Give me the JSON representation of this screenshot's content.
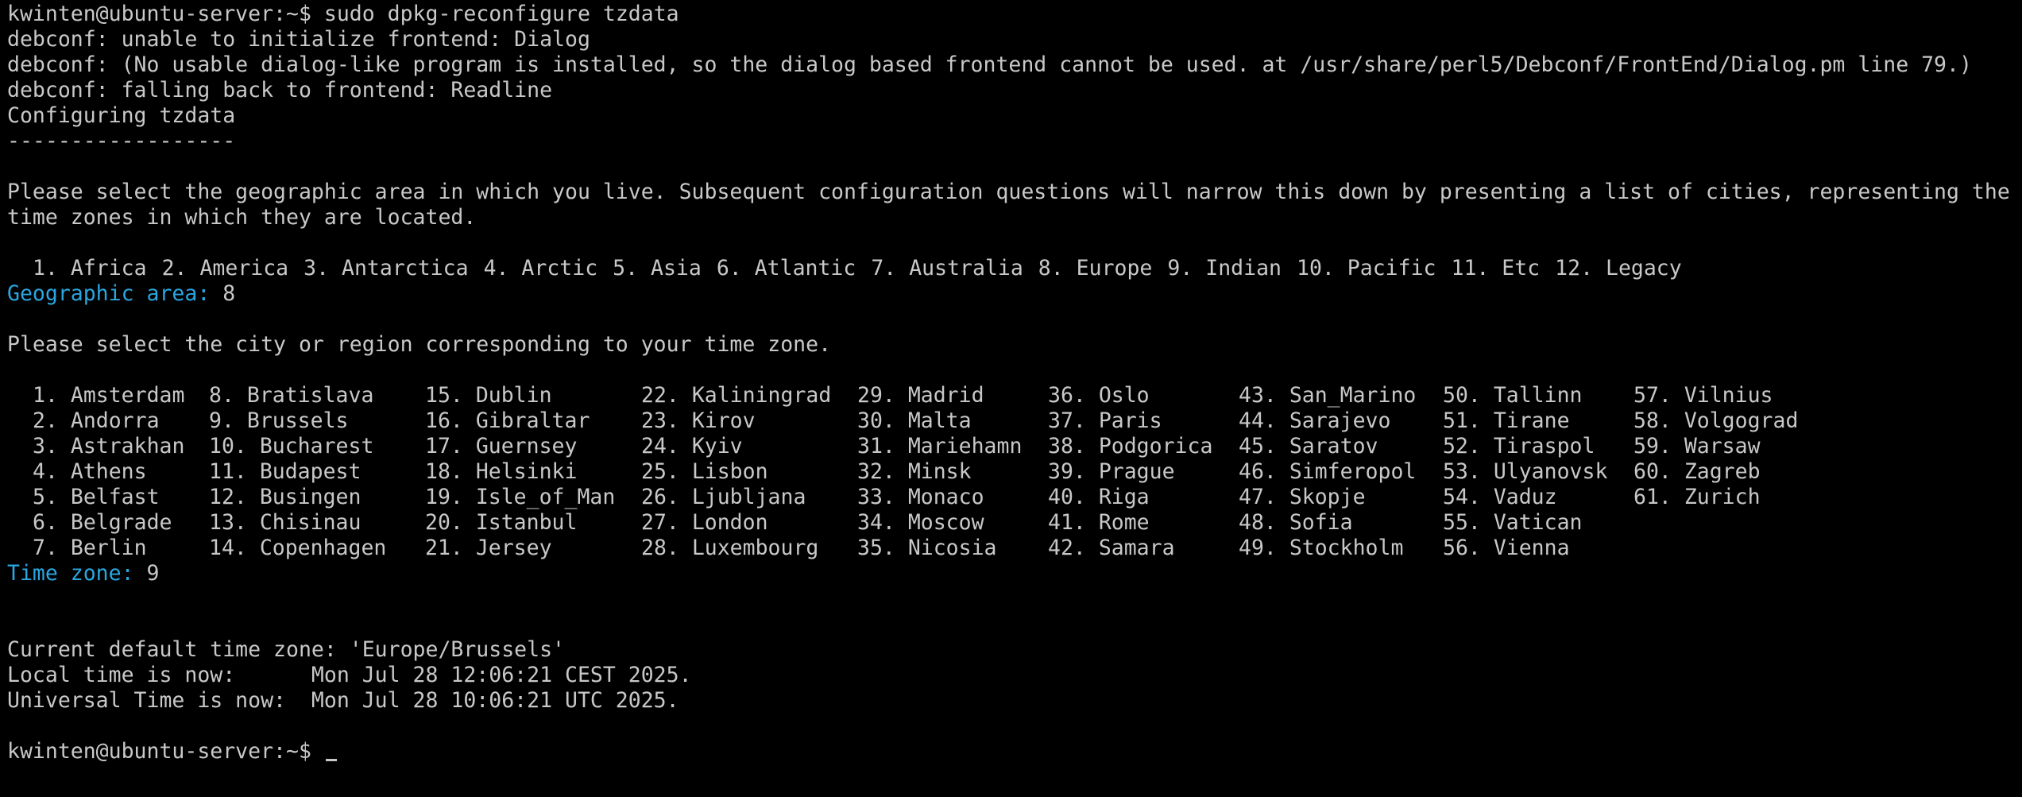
{
  "session": {
    "prompt": "kwinten@ubuntu-server:~$",
    "command": "sudo dpkg-reconfigure tzdata"
  },
  "messages": [
    "debconf: unable to initialize frontend: Dialog",
    "debconf: (No usable dialog-like program is installed, so the dialog based frontend cannot be used. at /usr/share/perl5/Debconf/FrontEnd/Dialog.pm line 79.)",
    "debconf: falling back to frontend: Readline",
    "Configuring tzdata",
    "------------------"
  ],
  "area_intro": [
    "Please select the geographic area in which you live. Subsequent configuration questions will narrow this down by presenting a list of cities, representing the",
    "time zones in which they are located."
  ],
  "areas": [
    "1. Africa",
    "2. America",
    "3. Antarctica",
    "4. Arctic",
    "5. Asia",
    "6. Atlantic",
    "7. Australia",
    "8. Europe",
    "9. Indian",
    "10. Pacific",
    "11. Etc",
    "12. Legacy"
  ],
  "area_prompt": {
    "label": "Geographic area:",
    "value": "8"
  },
  "city_intro": "Please select the city or region corresponding to your time zone.",
  "city_columns": [
    [
      "1. Amsterdam",
      "2. Andorra",
      "3. Astrakhan",
      "4. Athens",
      "5. Belfast",
      "6. Belgrade",
      "7. Berlin"
    ],
    [
      "8. Bratislava",
      "9. Brussels",
      "10. Bucharest",
      "11. Budapest",
      "12. Busingen",
      "13. Chisinau",
      "14. Copenhagen"
    ],
    [
      "15. Dublin",
      "16. Gibraltar",
      "17. Guernsey",
      "18. Helsinki",
      "19. Isle_of_Man",
      "20. Istanbul",
      "21. Jersey"
    ],
    [
      "22. Kaliningrad",
      "23. Kirov",
      "24. Kyiv",
      "25. Lisbon",
      "26. Ljubljana",
      "27. London",
      "28. Luxembourg"
    ],
    [
      "29. Madrid",
      "30. Malta",
      "31. Mariehamn",
      "32. Minsk",
      "33. Monaco",
      "34. Moscow",
      "35. Nicosia"
    ],
    [
      "36. Oslo",
      "37. Paris",
      "38. Podgorica",
      "39. Prague",
      "40. Riga",
      "41. Rome",
      "42. Samara"
    ],
    [
      "43. San_Marino",
      "44. Sarajevo",
      "45. Saratov",
      "46. Simferopol",
      "47. Skopje",
      "48. Sofia",
      "49. Stockholm"
    ],
    [
      "50. Tallinn",
      "51. Tirane",
      "52. Tiraspol",
      "53. Ulyanovsk",
      "54. Vaduz",
      "55. Vatican",
      "56. Vienna"
    ],
    [
      "57. Vilnius",
      "58. Volgograd",
      "59. Warsaw",
      "60. Zagreb",
      "61. Zurich"
    ]
  ],
  "tz_prompt": {
    "label": "Time zone:",
    "value": "9"
  },
  "result": [
    "Current default time zone: 'Europe/Brussels'",
    "Local time is now:      Mon Jul 28 12:06:21 CEST 2025.",
    "Universal Time is now:  Mon Jul 28 10:06:21 UTC 2025."
  ],
  "final_prompt": "kwinten@ubuntu-server:~$",
  "colors": {
    "background": "#000000",
    "foreground": "#c8c8c8",
    "prompt_label": "#2aa6e0"
  }
}
